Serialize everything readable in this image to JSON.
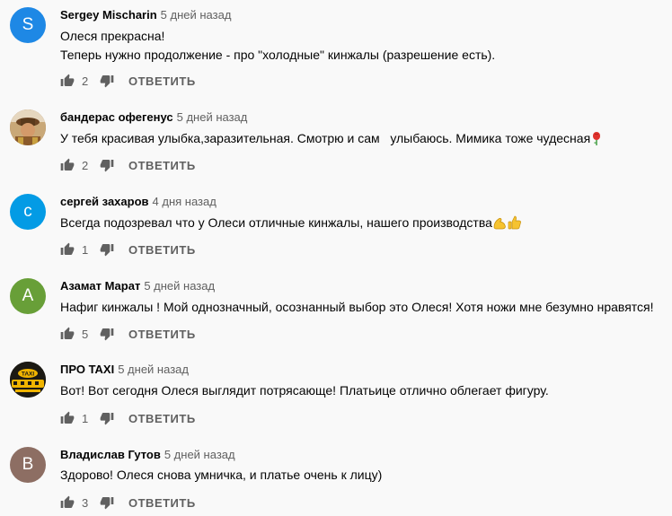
{
  "comments": [
    {
      "author": "Sergey Mischarin",
      "time": "5 дней назад",
      "lines": [
        "Олеся прекрасна!",
        "Теперь нужно продолжение - про \"холодные\" кинжалы (разрешение есть)."
      ],
      "likes": "2",
      "avatar_letter": "S",
      "avatar_color": "#1e88e5"
    },
    {
      "author": "бандерас офегенус",
      "time": "5 дней назад",
      "lines": [
        "У тебя красивая улыбка,заразительная. Смотрю и сам   улыбаюсь. Мимика тоже чудесная"
      ],
      "likes": "2",
      "avatar_icon": "photo-avatar-icon"
    },
    {
      "author": "сергей захаров",
      "time": "4 дня назад",
      "lines": [
        "Всегда подозревал что у Олеси отличные кинжалы, нашего производства"
      ],
      "likes": "1",
      "avatar_letter": "с",
      "avatar_color": "#039be5"
    },
    {
      "author": "Азамат Марат",
      "time": "5 дней назад",
      "lines": [
        "Нафиг кинжалы ! Мой однозначный, осознанный выбор это Олеся! Хотя ножи мне безумно нравятся!"
      ],
      "likes": "5",
      "avatar_letter": "A",
      "avatar_color": "#689f38"
    },
    {
      "author": "ПРО TAXI",
      "time": "5 дней назад",
      "lines": [
        "Вот! Вот сегодня Олеся выглядит потрясающе! Платьице отлично облегает фигуру."
      ],
      "likes": "1",
      "avatar_icon": "taxi-logo-icon",
      "avatar_logo_text": "TAXI"
    },
    {
      "author": "Владислав Гутов",
      "time": "5 дней назад",
      "lines": [
        "Здорово! Олеся снова умничка, и платье очень к лицу)"
      ],
      "likes": "3",
      "avatar_letter": "B",
      "avatar_color": "#8d6e63"
    }
  ],
  "labels": {
    "reply": "ОТВЕТИТЬ"
  },
  "icons": {
    "like": "thumb-up-icon",
    "dislike": "thumb-down-icon",
    "emoji_rose": "rose-emoji-icon",
    "emoji_muscle": "flexed-biceps-emoji-icon",
    "emoji_thumb": "thumbs-up-emoji-icon"
  },
  "colors": {
    "background": "#f9f9f9",
    "text": "#030303",
    "secondary": "#606060"
  }
}
